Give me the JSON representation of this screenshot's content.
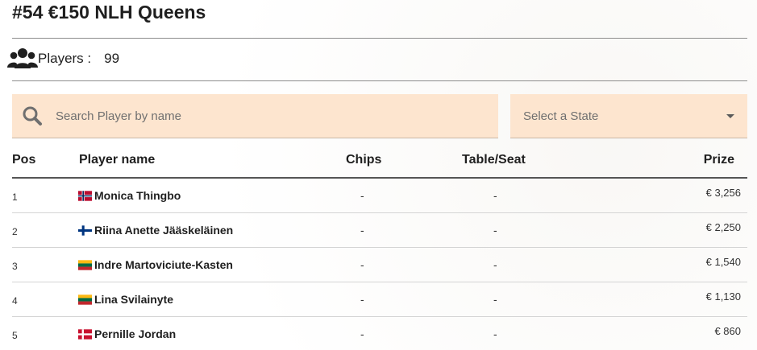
{
  "tournament": {
    "title": "#54 €150 NLH Queens"
  },
  "players": {
    "icon": "users-icon",
    "label": "Players :",
    "count": "99"
  },
  "search": {
    "icon": "search-icon",
    "placeholder": "Search Player by name",
    "value": ""
  },
  "state_select": {
    "selected": "Select a State",
    "icon": "caret-down-icon"
  },
  "table": {
    "headers": {
      "pos": "Pos",
      "name": "Player name",
      "chips": "Chips",
      "table_seat": "Table/Seat",
      "prize": "Prize"
    },
    "rows": [
      {
        "pos": "1",
        "flag": "norway-flag",
        "name": "Monica Thingbo",
        "chips": "-",
        "table_seat": "-",
        "prize": "€ 3,256"
      },
      {
        "pos": "2",
        "flag": "finland-flag",
        "name": "Riina Anette Jääskeläinen",
        "chips": "-",
        "table_seat": "-",
        "prize": "€ 2,250"
      },
      {
        "pos": "3",
        "flag": "lithuania-flag",
        "name": "Indre Martoviciute-Kasten",
        "chips": "-",
        "table_seat": "-",
        "prize": "€ 1,540"
      },
      {
        "pos": "4",
        "flag": "lithuania-flag",
        "name": "Lina Svilainyte",
        "chips": "-",
        "table_seat": "-",
        "prize": "€ 1,130"
      },
      {
        "pos": "5",
        "flag": "denmark-flag",
        "name": "Pernille Jordan",
        "chips": "-",
        "table_seat": "-",
        "prize": "€ 860"
      }
    ]
  },
  "colors": {
    "input_background": "#fde5cf",
    "text": "#1f1f1f",
    "divider": "#8c8c8c"
  }
}
